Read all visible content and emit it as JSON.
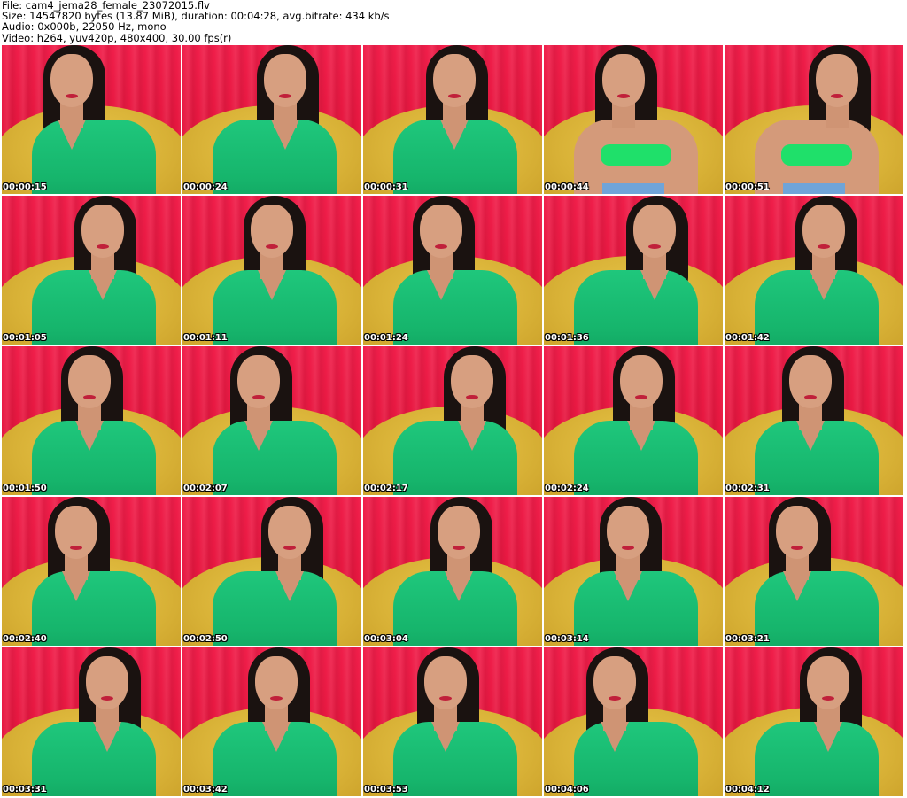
{
  "header": {
    "file_line": "File: cam4_jema28_female_23072015.flv",
    "size_line": "Size: 14547820 bytes (13.87 MiB), duration: 00:04:28, avg.bitrate: 434 kb/s",
    "audio_line": "Audio: 0x000b, 22050 Hz, mono",
    "video_line": "Video: h264, yuv420p, 480x400, 30.00 fps(r)"
  },
  "thumbnails": [
    {
      "time": "00:00:15",
      "variant": "shirt"
    },
    {
      "time": "00:00:24",
      "variant": "shirt"
    },
    {
      "time": "00:00:31",
      "variant": "shirt"
    },
    {
      "time": "00:00:44",
      "variant": "bikini"
    },
    {
      "time": "00:00:51",
      "variant": "bikini"
    },
    {
      "time": "00:01:05",
      "variant": "shirt"
    },
    {
      "time": "00:01:11",
      "variant": "shirt"
    },
    {
      "time": "00:01:24",
      "variant": "shirt"
    },
    {
      "time": "00:01:36",
      "variant": "shirt"
    },
    {
      "time": "00:01:42",
      "variant": "shirt"
    },
    {
      "time": "00:01:50",
      "variant": "shirt"
    },
    {
      "time": "00:02:07",
      "variant": "shirt"
    },
    {
      "time": "00:02:17",
      "variant": "shirt"
    },
    {
      "time": "00:02:24",
      "variant": "shirt"
    },
    {
      "time": "00:02:31",
      "variant": "shirt"
    },
    {
      "time": "00:02:40",
      "variant": "shirt"
    },
    {
      "time": "00:02:50",
      "variant": "shirt"
    },
    {
      "time": "00:03:04",
      "variant": "shirt"
    },
    {
      "time": "00:03:14",
      "variant": "shirt"
    },
    {
      "time": "00:03:21",
      "variant": "shirt"
    },
    {
      "time": "00:03:31",
      "variant": "shirt"
    },
    {
      "time": "00:03:42",
      "variant": "shirt"
    },
    {
      "time": "00:03:53",
      "variant": "shirt"
    },
    {
      "time": "00:04:06",
      "variant": "shirt"
    },
    {
      "time": "00:04:12",
      "variant": "shirt"
    }
  ]
}
